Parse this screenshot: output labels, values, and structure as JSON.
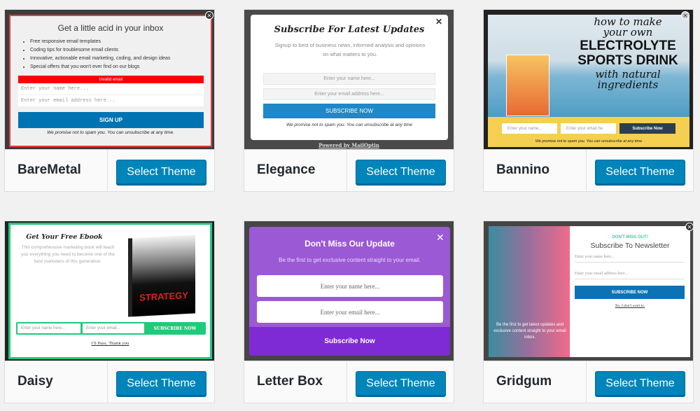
{
  "select_label": "Select Theme",
  "themes": [
    {
      "name": "BareMetal",
      "preview": {
        "title": "Get a little acid in your inbox",
        "bullets": [
          "Free responsive email templates",
          "Coding tips for troublesome email clients",
          "Innovative, actionable email marketing, coding, and design ideas",
          "Special offers that you won't ever find on our blogs"
        ],
        "error": "Invalid email",
        "name_placeholder": "Enter your name here...",
        "email_placeholder": "Enter your email address here...",
        "button": "SIGN UP",
        "note": "We promise not to spam you. You can unsubscribe at any time."
      }
    },
    {
      "name": "Elegance",
      "preview": {
        "title": "Subscribe For Latest Updates",
        "subtitle": "Signup to best of business news, informed analysis and opinions on what matters to you.",
        "name_placeholder": "Enter your name here...",
        "email_placeholder": "Enter your email address here...",
        "button": "SUBSCRIBE NOW",
        "note": "We promise not to spam you. You can unsubscribe at any time",
        "powered": "Powered by MailOptin"
      }
    },
    {
      "name": "Bannino",
      "preview": {
        "headline": [
          "how to make",
          "your own",
          "ELECTROLYTE",
          "SPORTS DRINK",
          "with natural",
          "ingredients"
        ],
        "name_placeholder": "Enter your name...",
        "email_placeholder": "Enter your email he",
        "button": "Subscribe Now",
        "note": "We promise not to spam you. You can unsubscribe at any time"
      }
    },
    {
      "name": "Daisy",
      "preview": {
        "title": "Get Your Free Ebook",
        "subtitle": "This comprehensive marketing book will teach you everything you need to become one of the best marketers of this generation.",
        "book_title": "STRATEGY",
        "name_placeholder": "Enter your name here...",
        "email_placeholder": "Enter your email...",
        "button": "SUBSCRIBE NOW",
        "decline": "I'll Pass, Thank you"
      }
    },
    {
      "name": "Letter Box",
      "preview": {
        "title": "Don't Miss Our Update",
        "subtitle": "Be the first to get exclusive content straight to your email.",
        "name_placeholder": "Enter your name here...",
        "email_placeholder": "Enter your email here...",
        "button": "Subscribe Now"
      }
    },
    {
      "name": "Gridgum",
      "preview": {
        "tag": "DON'T MISS OUT!",
        "title": "Subscribe To Newsletter",
        "side_text": "Be the first to get latest updates and exclusive content straight to your email inbox.",
        "name_placeholder": "Enter your name here...",
        "email_placeholder": "Enter your email address here...",
        "button": "SUBSCRIBE NOW",
        "decline": "No, I don't want to."
      }
    }
  ],
  "colors": {
    "button": "#0085ba",
    "baremetal_error": "#ff0000",
    "letterbox": "#9b59d6",
    "daisy_green": "#1ecb7a",
    "bannino_yellow": "#f5cf4f"
  }
}
